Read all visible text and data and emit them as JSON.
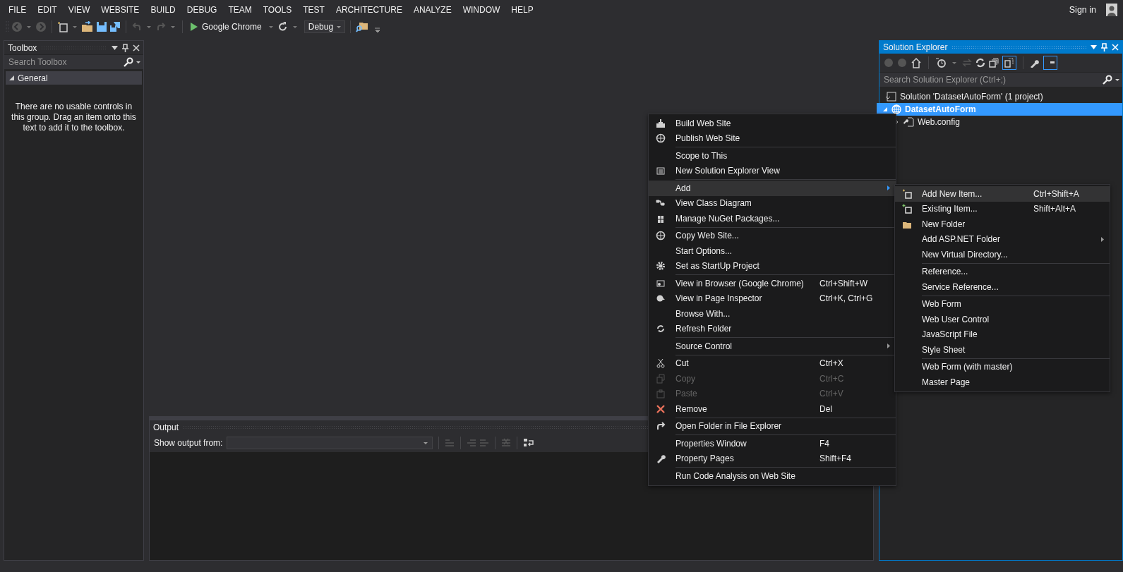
{
  "menu_bar": {
    "items": [
      "FILE",
      "EDIT",
      "VIEW",
      "WEBSITE",
      "BUILD",
      "DEBUG",
      "TEAM",
      "TOOLS",
      "TEST",
      "ARCHITECTURE",
      "ANALYZE",
      "WINDOW",
      "HELP"
    ],
    "sign_in": "Sign in"
  },
  "toolbar": {
    "run_target": "Google Chrome",
    "configuration": "Debug"
  },
  "toolbox": {
    "title": "Toolbox",
    "search": {
      "placeholder": "Search Toolbox"
    },
    "group": {
      "label": "General",
      "expanded": true
    },
    "empty_message": "There are no usable controls in this group. Drag an item onto this text to add it to the toolbox."
  },
  "output": {
    "title": "Output",
    "show_output_from": "Show output from:"
  },
  "solution_explorer": {
    "title": "Solution Explorer",
    "search": {
      "placeholder": "Search Solution Explorer (Ctrl+;)"
    },
    "tree": [
      {
        "label": "Solution 'DatasetAutoForm' (1 project)",
        "selected": false,
        "children": [
          {
            "label": "DatasetAutoForm",
            "selected": true,
            "expanded": true,
            "children": [
              {
                "label": "Web.config",
                "selected": false,
                "expanded": false
              }
            ]
          }
        ]
      }
    ]
  },
  "context_menu": {
    "items": [
      {
        "label": "Build Web Site",
        "separator_before": false,
        "selected": false,
        "disabled": false,
        "has_submenu": false
      },
      {
        "label": "Publish Web Site",
        "separator_before": false,
        "selected": false,
        "disabled": false,
        "has_submenu": false
      },
      {
        "label": "Scope to This",
        "separator_before": true,
        "selected": false,
        "disabled": false,
        "has_submenu": false
      },
      {
        "label": "New Solution Explorer View",
        "separator_before": false,
        "selected": false,
        "disabled": false,
        "has_submenu": false
      },
      {
        "label": "Add",
        "separator_before": true,
        "selected": true,
        "disabled": false,
        "has_submenu": true
      },
      {
        "label": "View Class Diagram",
        "separator_before": false,
        "selected": false,
        "disabled": false,
        "has_submenu": false
      },
      {
        "label": "Manage NuGet Packages...",
        "separator_before": false,
        "selected": false,
        "disabled": false,
        "has_submenu": false
      },
      {
        "label": "Copy Web Site...",
        "separator_before": true,
        "selected": false,
        "disabled": false,
        "has_submenu": false
      },
      {
        "label": "Start Options...",
        "separator_before": false,
        "selected": false,
        "disabled": false,
        "has_submenu": false
      },
      {
        "label": "Set as StartUp Project",
        "separator_before": false,
        "selected": false,
        "disabled": false,
        "has_submenu": false
      },
      {
        "label": "View in Browser (Google Chrome)",
        "shortcut": "Ctrl+Shift+W",
        "separator_before": true,
        "selected": false,
        "disabled": false,
        "has_submenu": false
      },
      {
        "label": "View in Page Inspector",
        "shortcut": "Ctrl+K, Ctrl+G",
        "separator_before": false,
        "selected": false,
        "disabled": false,
        "has_submenu": false
      },
      {
        "label": "Browse With...",
        "separator_before": false,
        "selected": false,
        "disabled": false,
        "has_submenu": false
      },
      {
        "label": "Refresh Folder",
        "separator_before": false,
        "selected": false,
        "disabled": false,
        "has_submenu": false
      },
      {
        "label": "Source Control",
        "separator_before": true,
        "selected": false,
        "disabled": false,
        "has_submenu": true
      },
      {
        "label": "Cut",
        "shortcut": "Ctrl+X",
        "separator_before": true,
        "selected": false,
        "disabled": false,
        "has_submenu": false
      },
      {
        "label": "Copy",
        "shortcut": "Ctrl+C",
        "separator_before": false,
        "selected": false,
        "disabled": true,
        "has_submenu": false
      },
      {
        "label": "Paste",
        "shortcut": "Ctrl+V",
        "separator_before": false,
        "selected": false,
        "disabled": true,
        "has_submenu": false
      },
      {
        "label": "Remove",
        "shortcut": "Del",
        "separator_before": false,
        "selected": false,
        "disabled": false,
        "has_submenu": false
      },
      {
        "label": "Open Folder in File Explorer",
        "separator_before": true,
        "selected": false,
        "disabled": false,
        "has_submenu": false
      },
      {
        "label": "Properties Window",
        "shortcut": "F4",
        "separator_before": true,
        "selected": false,
        "disabled": false,
        "has_submenu": false
      },
      {
        "label": "Property Pages",
        "shortcut": "Shift+F4",
        "separator_before": false,
        "selected": false,
        "disabled": false,
        "has_submenu": false
      },
      {
        "label": "Run Code Analysis on Web Site",
        "separator_before": true,
        "selected": false,
        "disabled": false,
        "has_submenu": false
      }
    ]
  },
  "submenu": {
    "items": [
      {
        "label": "Add New Item...",
        "shortcut": "Ctrl+Shift+A",
        "separator_before": false,
        "selected": true,
        "has_submenu": false
      },
      {
        "label": "Existing Item...",
        "shortcut": "Shift+Alt+A",
        "separator_before": false,
        "selected": false,
        "has_submenu": false
      },
      {
        "label": "New Folder",
        "separator_before": false,
        "selected": false,
        "has_submenu": false
      },
      {
        "label": "Add ASP.NET Folder",
        "separator_before": false,
        "selected": false,
        "has_submenu": true
      },
      {
        "label": "New Virtual Directory...",
        "separator_before": false,
        "selected": false,
        "has_submenu": false
      },
      {
        "label": "Reference...",
        "separator_before": true,
        "selected": false,
        "has_submenu": false
      },
      {
        "label": "Service Reference...",
        "separator_before": false,
        "selected": false,
        "has_submenu": false
      },
      {
        "label": "Web Form",
        "separator_before": true,
        "selected": false,
        "has_submenu": false
      },
      {
        "label": "Web User Control",
        "separator_before": false,
        "selected": false,
        "has_submenu": false
      },
      {
        "label": "JavaScript File",
        "separator_before": false,
        "selected": false,
        "has_submenu": false
      },
      {
        "label": "Style Sheet",
        "separator_before": false,
        "selected": false,
        "has_submenu": false
      },
      {
        "label": "Web Form (with master)",
        "separator_before": true,
        "selected": false,
        "has_submenu": false
      },
      {
        "label": "Master Page",
        "separator_before": false,
        "selected": false,
        "has_submenu": false
      }
    ]
  }
}
